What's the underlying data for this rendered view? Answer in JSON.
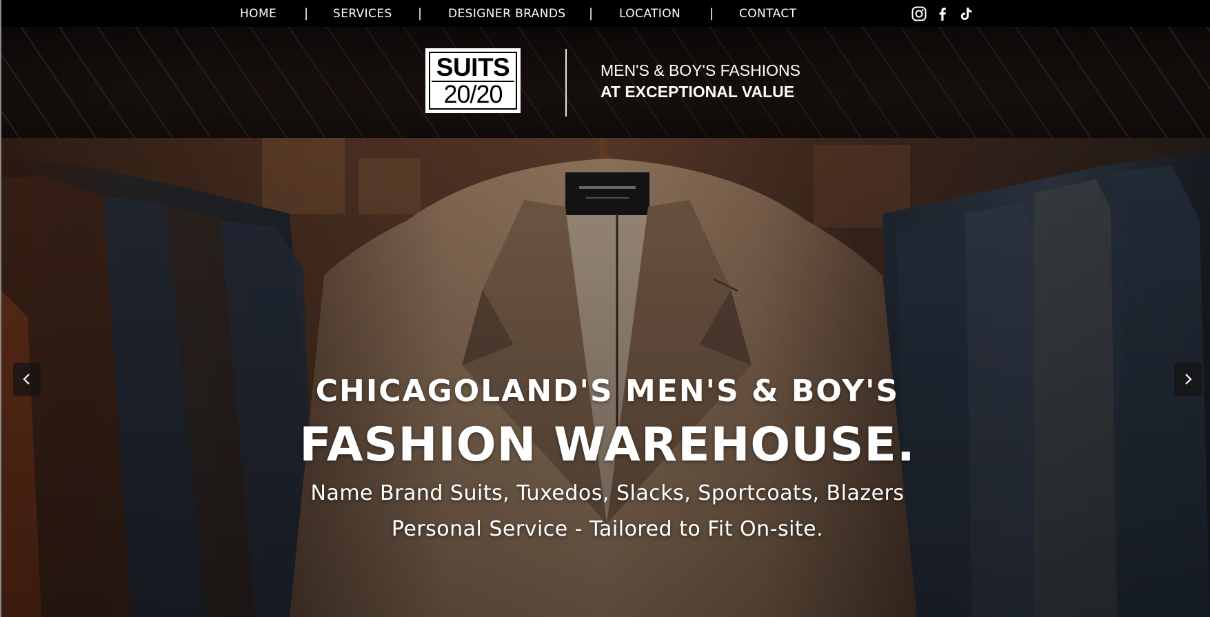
{
  "nav": {
    "items": [
      {
        "label": "HOME"
      },
      {
        "label": "SERVICES"
      },
      {
        "label": "DESIGNER BRANDS"
      },
      {
        "label": "LOCATION"
      },
      {
        "label": "CONTACT"
      }
    ],
    "separator": "|",
    "social": [
      {
        "icon": "instagram-icon"
      },
      {
        "icon": "facebook-icon"
      },
      {
        "icon": "tiktok-icon"
      }
    ]
  },
  "header": {
    "logo_top": "SUITS",
    "logo_bottom": "20/20",
    "tagline_1": "MEN'S & BOY'S FASHIONS",
    "tagline_2": "AT EXCEPTIONAL VALUE"
  },
  "hero": {
    "line1": "CHICAGOLAND'S MEN'S & BOY'S",
    "line2": "FASHION WAREHOUSE.",
    "line3": "Name Brand Suits, Tuxedos, Slacks, Sportcoats, Blazers",
    "line4": "Personal Service - Tailored to Fit On-site.",
    "prev_icon": "chevron-left-icon",
    "next_icon": "chevron-right-icon"
  },
  "colors": {
    "nav_bg": "#000000",
    "text": "#ffffff",
    "jacket": "#a8876b"
  }
}
